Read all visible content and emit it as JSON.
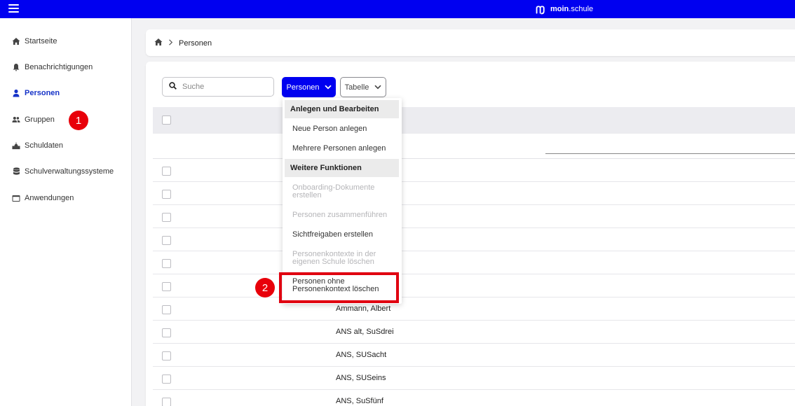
{
  "brand": {
    "name_bold": "moin",
    "name_rest": ".schule"
  },
  "sidebar": {
    "items": [
      {
        "label": "Startseite",
        "icon": "home-icon"
      },
      {
        "label": "Benachrichtigungen",
        "icon": "bell-icon"
      },
      {
        "label": "Personen",
        "icon": "person-icon",
        "active": true
      },
      {
        "label": "Gruppen",
        "icon": "group-icon"
      },
      {
        "label": "Schuldaten",
        "icon": "school-icon"
      },
      {
        "label": "Schulverwaltungssysteme",
        "icon": "database-icon"
      },
      {
        "label": "Anwendungen",
        "icon": "window-icon"
      }
    ]
  },
  "breadcrumb": {
    "current": "Personen"
  },
  "toolbar": {
    "search_placeholder": "Suche",
    "personen_button": "Personen",
    "tabelle_button": "Tabelle"
  },
  "dropdown": {
    "section1": "Anlegen und Bearbeiten",
    "item_neue_person": "Neue Person anlegen",
    "item_mehrere_personen": "Mehrere Personen anlegen",
    "section2": "Weitere Funktionen",
    "item_onboarding_1": "Onboarding-Dokumente",
    "item_onboarding_2": "erstellen",
    "item_zusammenfuehren": "Personen zusammenführen",
    "item_sichtfreigaben": "Sichtfreigaben erstellen",
    "item_kontexte_1": "Personenkontexte in der",
    "item_kontexte_2": "eigenen Schule löschen",
    "item_ohne_kontext_1": "Personen ohne",
    "item_ohne_kontext_2": "Personenkontext löschen"
  },
  "table": {
    "rows": [
      "Ammann, Albert",
      "ANS alt, SuSdrei",
      "ANS, SUSacht",
      "ANS, SUSeins",
      "ANS, SuSfünf"
    ]
  },
  "markers": {
    "one": "1",
    "two": "2"
  },
  "colors": {
    "topbar": "#0000f0",
    "accent": "#1633c8",
    "marker": "#e8000a"
  }
}
